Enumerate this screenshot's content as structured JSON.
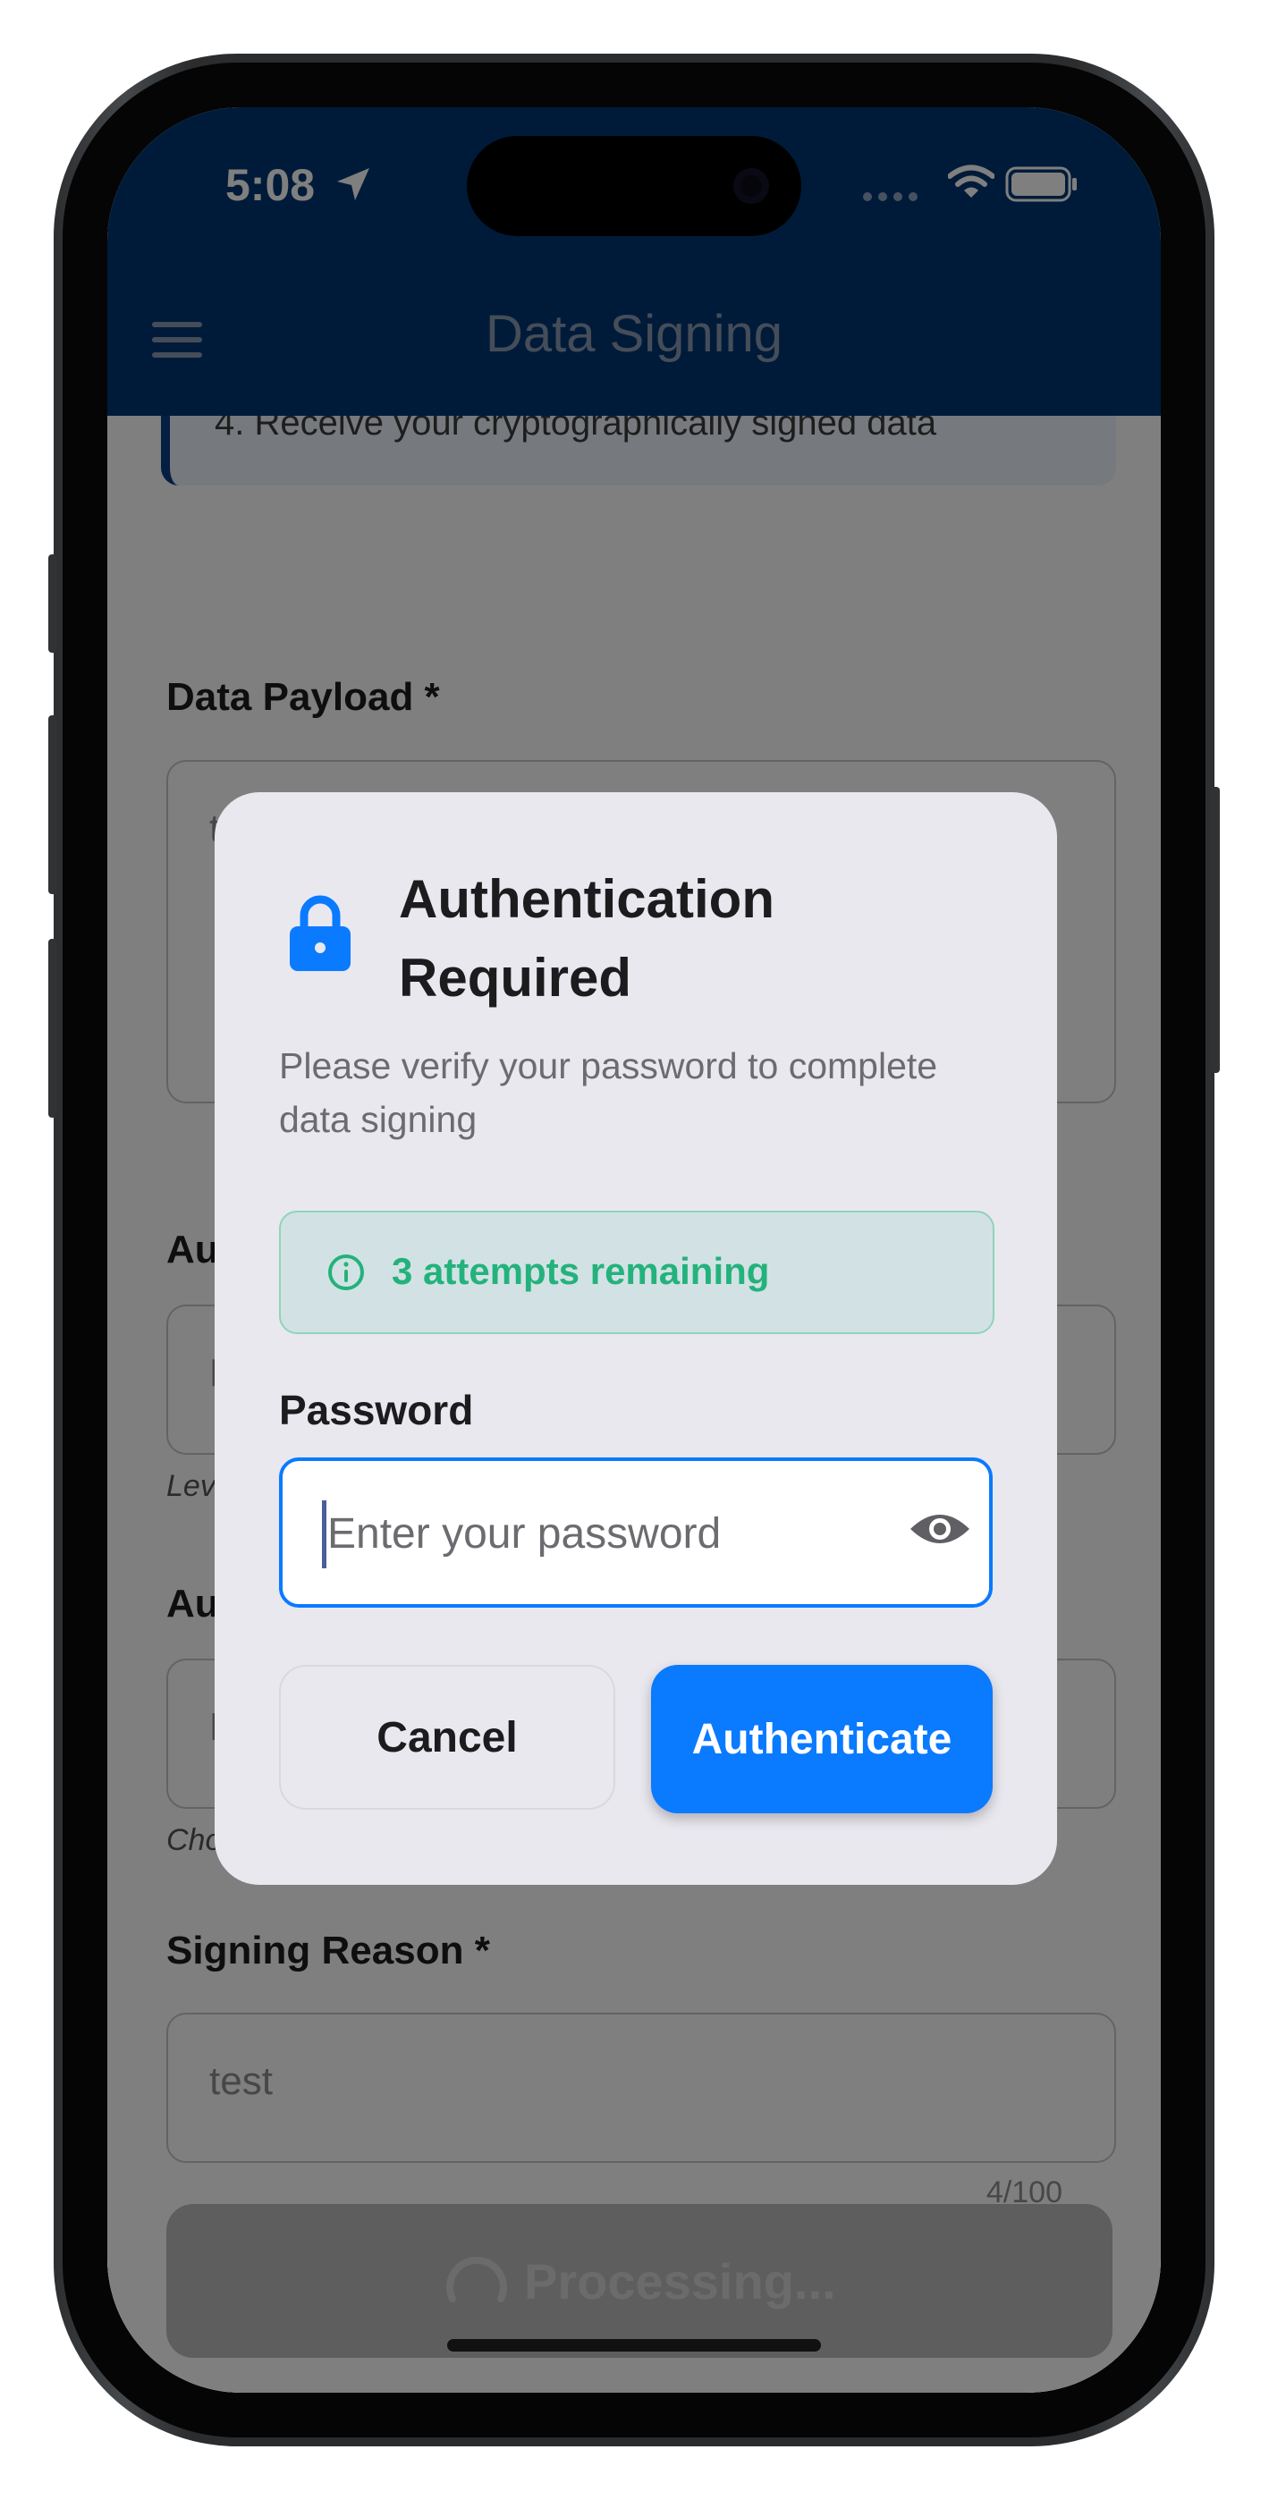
{
  "status_bar": {
    "time": "5:08"
  },
  "header": {
    "title": "Data Signing"
  },
  "page": {
    "info_last_step": "4. Receive your cryptographically signed data",
    "data_payload": {
      "label": "Data Payload *",
      "value": "test"
    },
    "auth_field_1": {
      "label": "Au",
      "value": "P",
      "hint": "Lev"
    },
    "auth_field_2": {
      "label": "Au",
      "value": "N",
      "hint": "Cho"
    },
    "signing_reason": {
      "label": "Signing Reason *",
      "value": "test",
      "counter": "4/100"
    },
    "process_button": {
      "label": "Processing..."
    }
  },
  "modal": {
    "title": "Authentication Required",
    "subtitle": "Please verify your password to complete data signing",
    "attempts": "3 attempts remaining",
    "password_label": "Password",
    "password_placeholder": "Enter your password",
    "cancel_label": "Cancel",
    "authenticate_label": "Authenticate"
  },
  "colors": {
    "header_bg": "#003772",
    "primary": "#0a7aff",
    "success": "#23b27c",
    "modal_bg": "#e9e8ef"
  }
}
